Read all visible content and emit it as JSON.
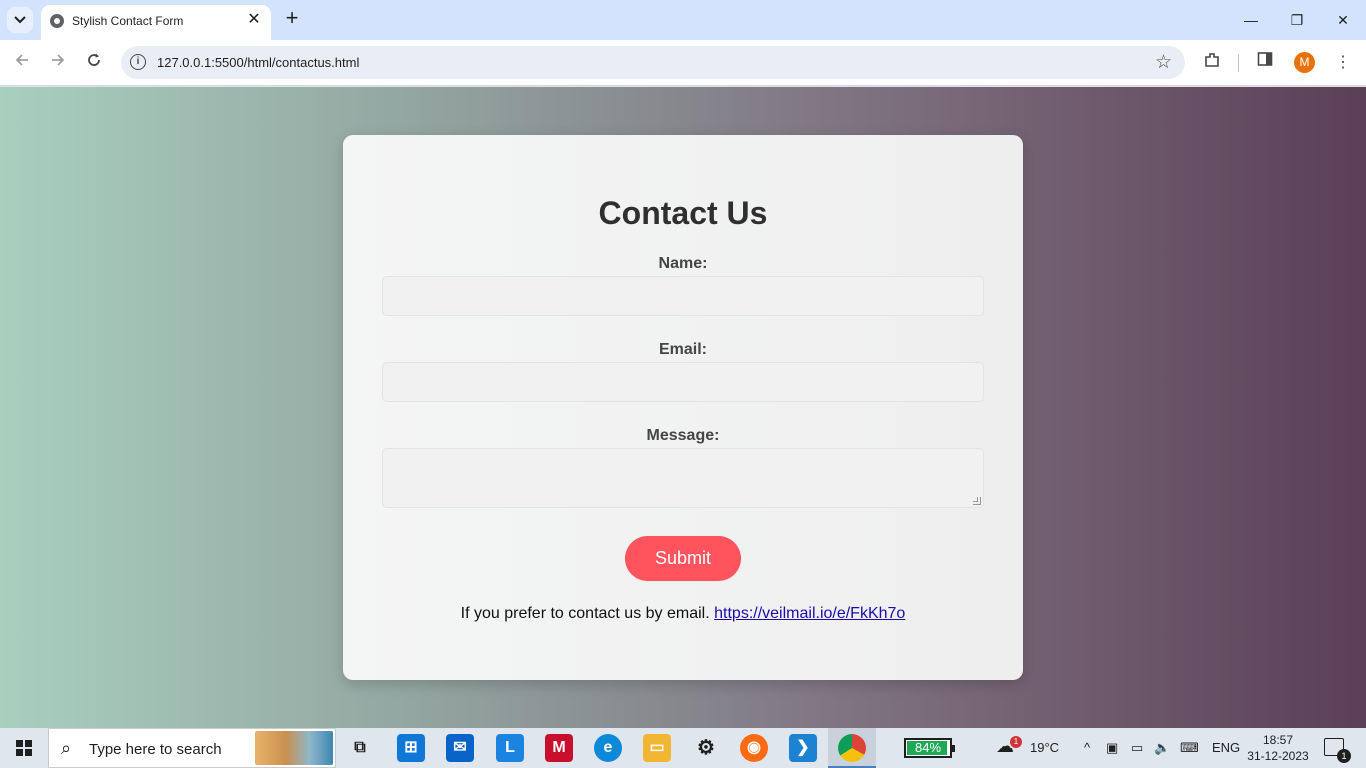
{
  "browser": {
    "tab_title": "Stylish Contact Form",
    "tab_close": "✕",
    "new_tab": "+",
    "url": "127.0.0.1:5500/html/contactus.html",
    "profile_initial": "M",
    "window_controls": {
      "minimize": "—",
      "restore": "❐",
      "close": "✕"
    }
  },
  "form": {
    "title": "Contact Us",
    "name_label": "Name:",
    "name_value": "",
    "email_label": "Email:",
    "email_value": "",
    "message_label": "Message:",
    "message_value": "",
    "submit_label": "Submit",
    "email_note": "If you prefer to contact us by email.",
    "email_link": "https://veilmail.io/e/FkKh7o",
    "colors": {
      "submit": "#ff535d",
      "link": "#1a0dab"
    }
  },
  "taskbar": {
    "search_placeholder": "Type here to search",
    "battery_percent": "84%",
    "weather_temp": "19°C",
    "weather_badge": "1",
    "language": "ENG",
    "time": "18:57",
    "date": "31-12-2023",
    "notification_count": "1",
    "pinned_apps": [
      "task-view",
      "microsoft-store",
      "mail",
      "launcher-l",
      "mcafee",
      "edge",
      "file-explorer",
      "settings",
      "firefox",
      "vs-code",
      "chrome"
    ]
  }
}
